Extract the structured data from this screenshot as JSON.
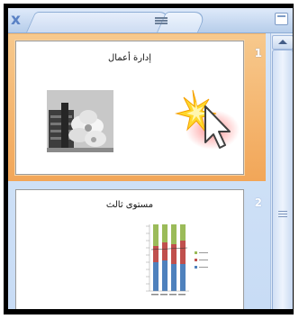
{
  "tabbar": {
    "close_icon": "close-icon",
    "close_glyph": "x",
    "slides_tab_icon": "slides-tab",
    "outline_tab_icon": "outline-icon",
    "minimize_icon": "minimize-icon"
  },
  "slides": [
    {
      "number": "1",
      "title": "إدارة أعمال",
      "selected": true
    },
    {
      "number": "2",
      "title": "مستوى ثالث",
      "selected": false
    }
  ],
  "colors": {
    "selected_row": "#f2a658",
    "panel_bg": "#d5e5f8",
    "accent_blue": "#5a82c5"
  }
}
